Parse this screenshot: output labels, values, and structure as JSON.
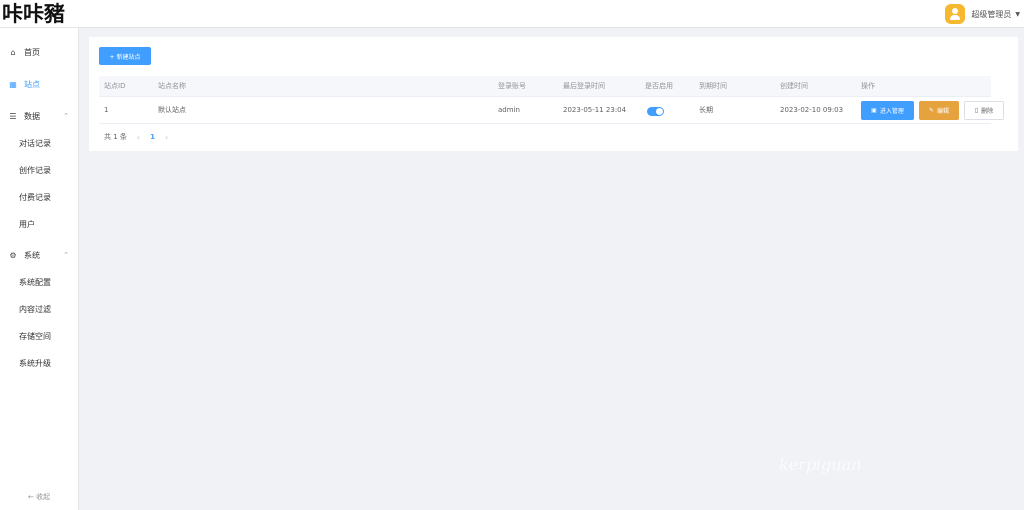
{
  "header": {
    "logo": "咔咔豬",
    "user_name": "超级管理员"
  },
  "sidebar": {
    "items": [
      {
        "label": "首页",
        "icon": "home-icon"
      },
      {
        "label": "站点",
        "icon": "grid-icon"
      },
      {
        "label": "数据",
        "icon": "list-icon"
      },
      {
        "label": "系统",
        "icon": "settings-icon"
      }
    ],
    "data_sub": [
      "对话记录",
      "创作记录",
      "付费记录",
      "用户"
    ],
    "system_sub": [
      "系统配置",
      "内容过滤",
      "存储空间",
      "系统升级"
    ],
    "collapse_label": "收起"
  },
  "main": {
    "create_button": "+ 新建站点",
    "columns": [
      "站点ID",
      "站点名称",
      "登录账号",
      "最后登录时间",
      "是否启用",
      "到期时间",
      "创建时间",
      "操作"
    ],
    "rows": [
      {
        "id": "1",
        "name": "默认站点",
        "account": "admin",
        "last_login": "2023-05-11 23:04",
        "enabled": true,
        "expire": "长期",
        "created": "2023-02-10 09:03",
        "actions": {
          "manage": "进入管理",
          "edit": "编辑",
          "delete": "删除"
        }
      }
    ],
    "pagination": {
      "total": "共 1 条",
      "current_page": "1"
    }
  },
  "watermark": "kerpiguan",
  "colors": {
    "primary": "#409eff",
    "warning": "#e6a23c",
    "avatar": "#f5b82e"
  }
}
